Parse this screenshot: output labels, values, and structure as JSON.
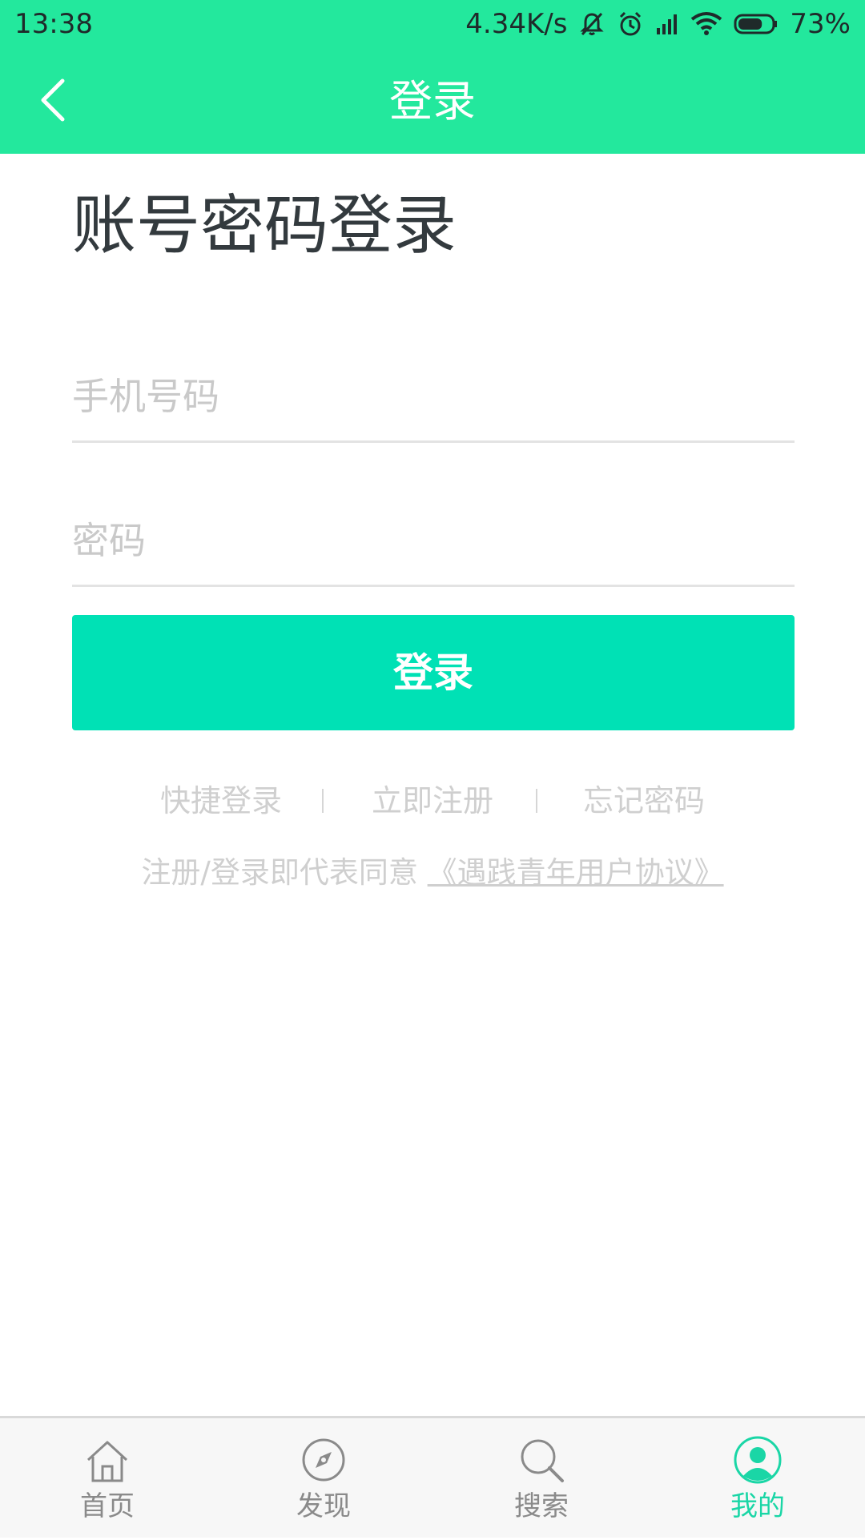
{
  "status_bar": {
    "time": "13:38",
    "net_speed": "4.34K/s",
    "battery_percent": "73%",
    "battery_level": 0.73,
    "icons": [
      "mute-icon",
      "alarm-icon",
      "signal-icon",
      "wifi-icon",
      "battery-icon"
    ]
  },
  "app_bar": {
    "title": "登录",
    "back_icon": "back-arrow-icon"
  },
  "form": {
    "heading": "账号密码登录",
    "phone_placeholder": "手机号码",
    "phone_value": "",
    "password_placeholder": "密码",
    "password_value": "",
    "login_button": "登录"
  },
  "links": {
    "quick_login": "快捷登录",
    "register": "立即注册",
    "forgot_password": "忘记密码"
  },
  "agreement": {
    "prefix": "注册/登录即代表同意",
    "link_text": "《遇践青年用户协议》"
  },
  "bottom_nav": {
    "items": [
      {
        "label": "首页",
        "icon": "home-icon",
        "active": false
      },
      {
        "label": "发现",
        "icon": "compass-icon",
        "active": false
      },
      {
        "label": "搜索",
        "icon": "search-icon",
        "active": false
      },
      {
        "label": "我的",
        "icon": "user-icon",
        "active": true
      }
    ]
  },
  "colors": {
    "header_green": "#23e89d",
    "button_teal": "#00e1b5",
    "active_tab": "#1ad6a6",
    "placeholder_gray": "#c9c9c9"
  }
}
